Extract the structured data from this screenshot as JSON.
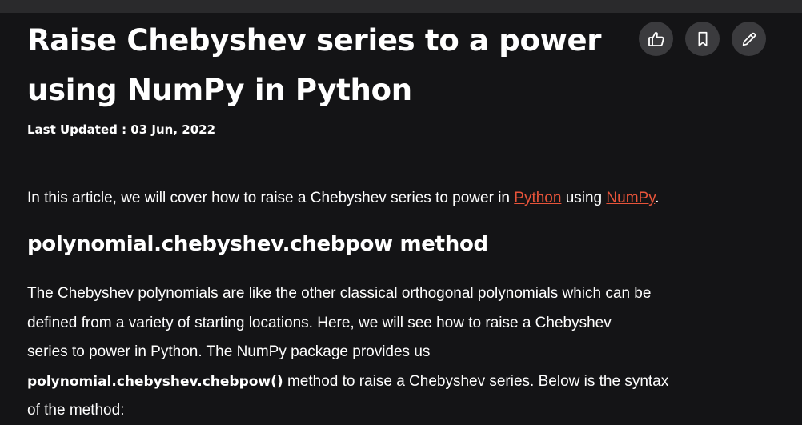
{
  "article": {
    "title_line1": "Raise Chebyshev series to a power",
    "title_line2": "using NumPy in Python",
    "last_updated": "Last Updated : 03 Jun, 2022",
    "intro": {
      "before": "In this article, we will cover how to raise a Chebyshev series to power in ",
      "link_python": "Python",
      "middle": " using ",
      "link_numpy": "NumPy",
      "after": "."
    },
    "section_heading": "polynomial.chebyshev.chebpow method",
    "paragraph": {
      "line1": "The Chebyshev polynomials are like the other classical orthogonal polynomials which can be",
      "line2": "defined from a variety of starting locations.  Here, we will see how to raise a Chebyshev",
      "line3": "series to power in Python. The NumPy package provides us",
      "line4_code": "polynomial.chebyshev.chebpow()",
      "line4_rest": " method to raise a Chebyshev series. Below is the syntax",
      "line5": "of the method:"
    }
  },
  "actions": {
    "like_icon": "thumbs-up-icon",
    "bookmark_icon": "bookmark-icon",
    "edit_icon": "pencil-icon"
  },
  "colors": {
    "background": "#141416",
    "text": "#ffffff",
    "link": "#e8543a",
    "button_bg": "#3b3b3e"
  }
}
